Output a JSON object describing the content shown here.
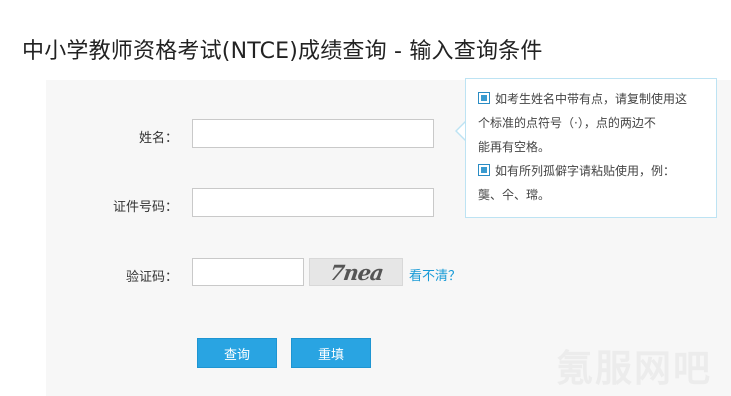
{
  "page": {
    "title": "中小学教师资格考试(NTCE)成绩查询 - 输入查询条件"
  },
  "form": {
    "name_label": "姓名：",
    "name_value": "",
    "id_label": "证件号码：",
    "id_value": "",
    "captcha_label": "验证码：",
    "captcha_value": "",
    "captcha_image_text": "7nea",
    "refresh_link": "看不清？"
  },
  "tips": {
    "item1_line1": "如考生姓名中带有点，请复制使用这",
    "item1_line2": "个标准的点符号（·），点的两边不",
    "item1_line3": "能再有空格。",
    "item2_line1": "如有所列孤僻字请粘贴使用，例：",
    "item2_line2": "龑、仐、瑺。"
  },
  "buttons": {
    "query": "查询",
    "reset": "重填"
  },
  "watermark": "氪服网吧",
  "colors": {
    "accent": "#29a4e2",
    "link": "#1a9bd7",
    "tip_border": "#bde3f3"
  }
}
